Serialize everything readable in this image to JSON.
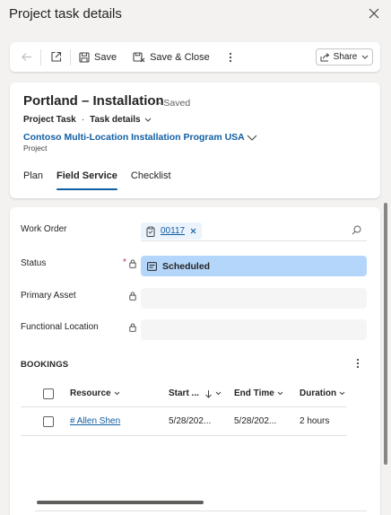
{
  "dialog": {
    "title": "Project task details"
  },
  "commandbar": {
    "save_label": "Save",
    "save_close_label": "Save & Close",
    "share_label": "Share"
  },
  "record": {
    "title": "Portland – Installation",
    "saved_status": "- Saved",
    "entity_name": "Project Task",
    "form_name": "Task details",
    "project_name": "Contoso Multi-Location Installation Program USA",
    "project_label": "Project"
  },
  "tabs": [
    {
      "label": "Plan",
      "active": false
    },
    {
      "label": "Field Service",
      "active": true
    },
    {
      "label": "Checklist",
      "active": false
    }
  ],
  "fields": {
    "work_order": {
      "label": "Work Order",
      "value": "00117"
    },
    "status": {
      "label": "Status",
      "required": "*",
      "value": "Scheduled"
    },
    "primary_asset": {
      "label": "Primary Asset",
      "value": ""
    },
    "functional_location": {
      "label": "Functional Location",
      "value": ""
    }
  },
  "bookings": {
    "title": "BOOKINGS",
    "columns": [
      "Resource",
      "Start ...",
      "End Time",
      "Duration"
    ],
    "rows": [
      {
        "resource": "# Allen Shen",
        "start": "5/28/202...",
        "end": "5/28/202...",
        "duration": "2 hours"
      }
    ]
  },
  "colors": {
    "accent": "#115ea3",
    "status_fill": "#b4d6fa",
    "background": "#f3f2f1"
  }
}
